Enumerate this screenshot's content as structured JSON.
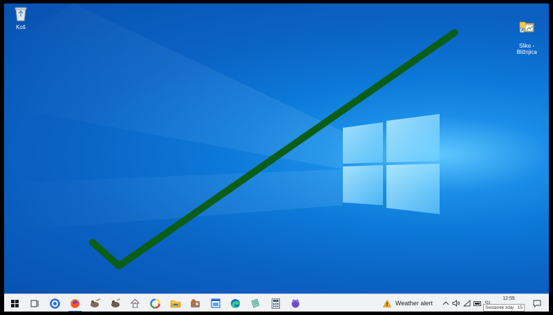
{
  "desktop": {
    "icons": [
      {
        "label": "Koš",
        "icon": "recycle-bin-icon"
      },
      {
        "label": "Slike -\nBližnjica",
        "icon": "folder-shortcut-icon"
      }
    ],
    "annotation_color": "#0a5e18"
  },
  "taskbar": {
    "apps": [
      {
        "name": "start",
        "icon": "windows-start-icon"
      },
      {
        "name": "task-view",
        "icon": "task-view-icon"
      },
      {
        "name": "app",
        "icon": "blue-ring-app-icon"
      },
      {
        "name": "firefox",
        "icon": "firefox-icon",
        "active": true
      },
      {
        "name": "gimp-1",
        "icon": "gimp-icon"
      },
      {
        "name": "gimp-2",
        "icon": "gimp-icon"
      },
      {
        "name": "inkscape",
        "icon": "inkscape-icon"
      },
      {
        "name": "color-app",
        "icon": "color-wheel-icon"
      },
      {
        "name": "file-explorer",
        "icon": "folder-icon"
      },
      {
        "name": "app-brown",
        "icon": "brown-app-icon"
      },
      {
        "name": "window-app",
        "icon": "window-icon"
      },
      {
        "name": "edge",
        "icon": "edge-icon"
      },
      {
        "name": "notes",
        "icon": "notes-icon"
      },
      {
        "name": "calculator",
        "icon": "calculator-icon"
      },
      {
        "name": "purple-app",
        "icon": "purple-app-icon"
      }
    ],
    "weather_text": "Weather alert",
    "tray_lang": "SL",
    "time": "12:55",
    "tooltip": "Sestanek zdaj",
    "tooltip_suffix": "15"
  }
}
